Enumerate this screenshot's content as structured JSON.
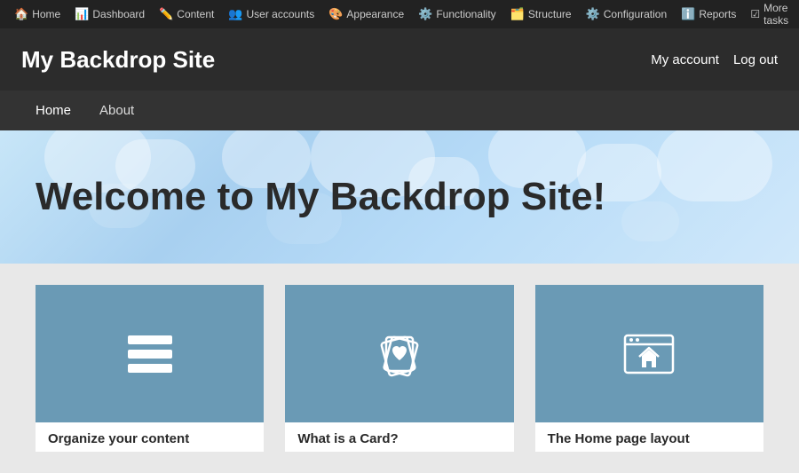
{
  "adminToolbar": {
    "items": [
      {
        "label": "Home",
        "icon": "🏠"
      },
      {
        "label": "Dashboard",
        "icon": "📊"
      },
      {
        "label": "Content",
        "icon": "✏️"
      },
      {
        "label": "User accounts",
        "icon": "👥"
      },
      {
        "label": "Appearance",
        "icon": "🎨"
      },
      {
        "label": "Functionality",
        "icon": "⚙️"
      },
      {
        "label": "Structure",
        "icon": "🗂️"
      },
      {
        "label": "Configuration",
        "icon": "⚙️"
      },
      {
        "label": "Reports",
        "icon": "ℹ️"
      }
    ],
    "moreTasks": "More tasks"
  },
  "siteHeader": {
    "title": "My Backdrop Site",
    "nav": [
      {
        "label": "My account"
      },
      {
        "label": "Log out"
      }
    ]
  },
  "mainNav": [
    {
      "label": "Home",
      "active": true
    },
    {
      "label": "About",
      "active": false
    }
  ],
  "hero": {
    "title": "Welcome to My Backdrop Site!"
  },
  "cards": [
    {
      "title": "Organize your content",
      "iconType": "database"
    },
    {
      "title": "What is a Card?",
      "iconType": "cards"
    },
    {
      "title": "The Home page layout",
      "iconType": "layout"
    }
  ]
}
